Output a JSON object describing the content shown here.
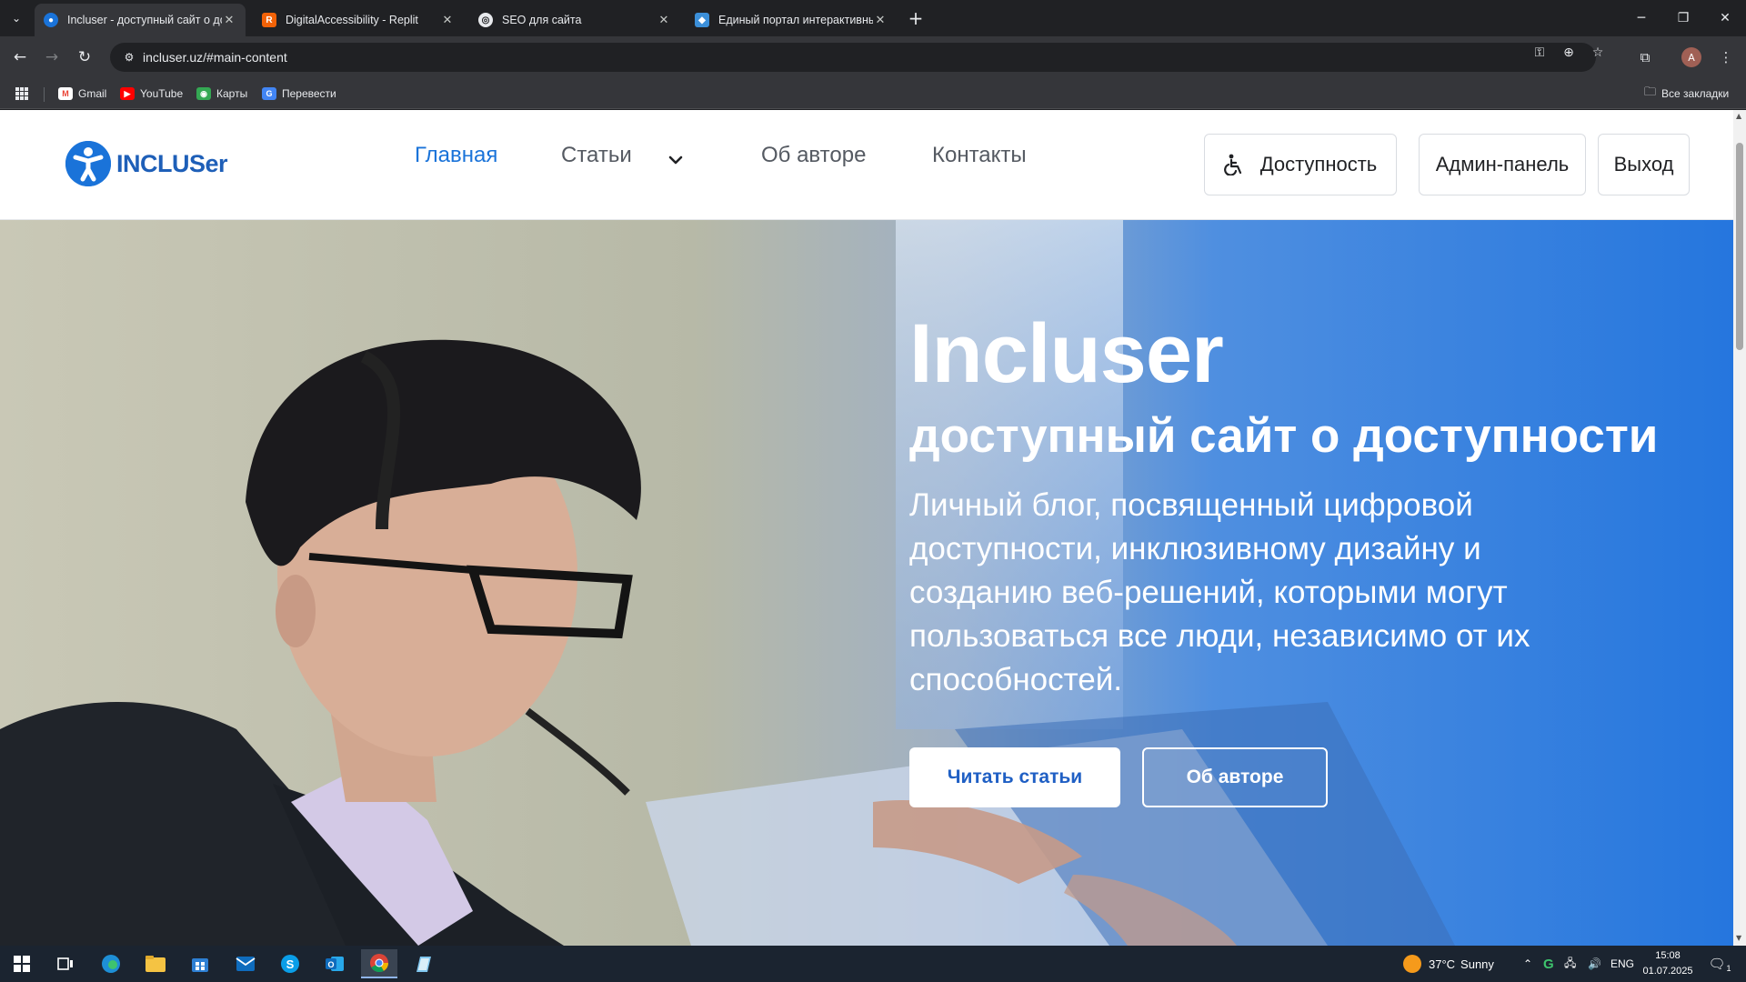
{
  "browser": {
    "tabs": [
      {
        "title": "Incluser - доступный сайт о до",
        "active": true
      },
      {
        "title": "DigitalAccessibility - Replit",
        "active": false
      },
      {
        "title": "SEO для сайта",
        "active": false
      },
      {
        "title": "Единый портал интерактивны",
        "active": false
      }
    ],
    "url": "incluser.uz/#main-content",
    "profile_initial": "A",
    "bookmarks": [
      {
        "label": "Gmail",
        "icon": "gmail-icon"
      },
      {
        "label": "YouTube",
        "icon": "youtube-icon"
      },
      {
        "label": "Карты",
        "icon": "maps-icon"
      },
      {
        "label": "Перевести",
        "icon": "translate-icon"
      }
    ],
    "all_bookmarks": "Все закладки"
  },
  "site": {
    "logo_text": "INCLUSer",
    "nav": [
      {
        "label": "Главная",
        "active": true
      },
      {
        "label": "Статьи",
        "active": false
      },
      {
        "label": "Об авторе",
        "active": false
      },
      {
        "label": "Контакты",
        "active": false
      }
    ],
    "header_buttons": {
      "accessibility": "Доступность",
      "admin": "Админ-панель",
      "logout": "Выход"
    },
    "hero": {
      "title": "Incluser",
      "subtitle": "доступный сайт о доступности",
      "description": "Личный блог, посвященный цифровой доступности, инклюзивному дизайну и созданию веб-решений, которыми могут пользоваться все люди, независимо от их способностей.",
      "primary_button": "Читать статьи",
      "secondary_button": "Об авторе"
    }
  },
  "taskbar": {
    "weather_temp": "37°C",
    "weather_text": "Sunny",
    "language": "ENG",
    "time": "15:08",
    "date": "01.07.2025",
    "notification_count": "1"
  },
  "colors": {
    "accent": "#1a73d9",
    "hero_blue": "#2576de",
    "chrome_dark": "#202124",
    "chrome_toolbar": "#35363a"
  }
}
